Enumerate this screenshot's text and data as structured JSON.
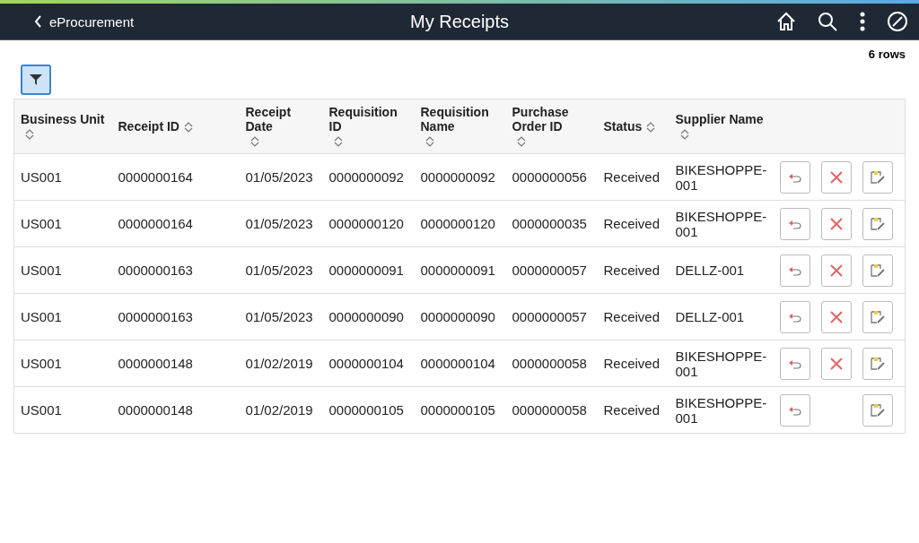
{
  "header": {
    "back_label": "eProcurement",
    "title": "My Receipts"
  },
  "row_count": "6 rows",
  "table": {
    "columns": [
      {
        "label": "Business Unit",
        "sortable": true
      },
      {
        "label": "Receipt ID",
        "sortable": true
      },
      {
        "label": "Receipt Date",
        "sortable": true
      },
      {
        "label": "Requisition ID",
        "sortable": true
      },
      {
        "label": "Requisition Name",
        "sortable": true
      },
      {
        "label": "Purchase Order ID",
        "sortable": true
      },
      {
        "label": "Status",
        "sortable": true
      },
      {
        "label": "Supplier Name",
        "sortable": true
      }
    ],
    "rows": [
      {
        "cells": [
          "US001",
          "0000000164",
          "01/05/2023",
          "0000000092",
          "0000000092",
          "0000000056",
          "Received",
          "BIKESHOPPE-001"
        ],
        "can_cancel": true
      },
      {
        "cells": [
          "US001",
          "0000000164",
          "01/05/2023",
          "0000000120",
          "0000000120",
          "0000000035",
          "Received",
          "BIKESHOPPE-001"
        ],
        "can_cancel": true
      },
      {
        "cells": [
          "US001",
          "0000000163",
          "01/05/2023",
          "0000000091",
          "0000000091",
          "0000000057",
          "Received",
          "DELLZ-001"
        ],
        "can_cancel": true
      },
      {
        "cells": [
          "US001",
          "0000000163",
          "01/05/2023",
          "0000000090",
          "0000000090",
          "0000000057",
          "Received",
          "DELLZ-001"
        ],
        "can_cancel": true
      },
      {
        "cells": [
          "US001",
          "0000000148",
          "01/02/2019",
          "0000000104",
          "0000000104",
          "0000000058",
          "Received",
          "BIKESHOPPE-001"
        ],
        "can_cancel": true
      },
      {
        "cells": [
          "US001",
          "0000000148",
          "01/02/2019",
          "0000000105",
          "0000000105",
          "0000000058",
          "Received",
          "BIKESHOPPE-001"
        ],
        "can_cancel": false
      }
    ]
  }
}
